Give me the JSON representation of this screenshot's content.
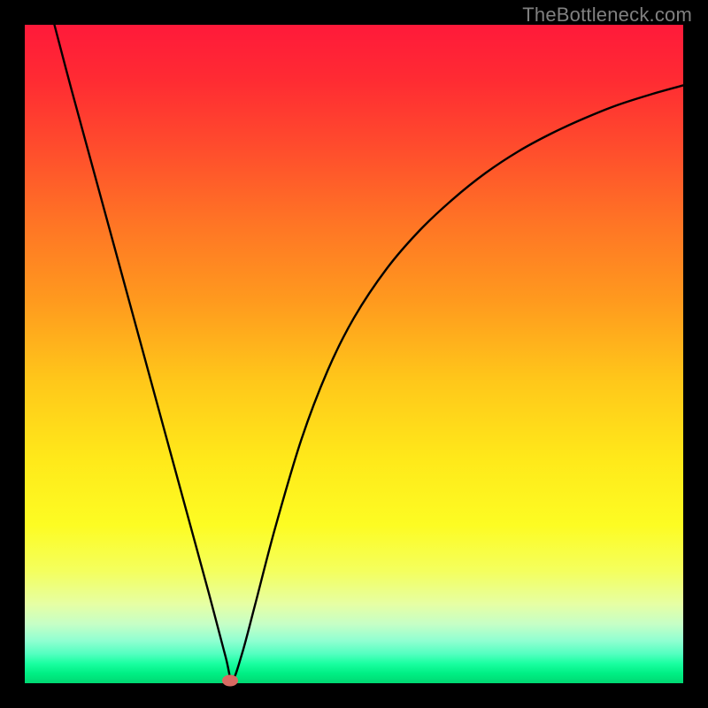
{
  "watermark": "TheBottleneck.com",
  "chart_data": {
    "type": "line",
    "title": "",
    "xlabel": "",
    "ylabel": "",
    "xlim": [
      0,
      1
    ],
    "ylim": [
      0,
      1
    ],
    "series": [
      {
        "name": "bottleneck-curve",
        "x": [
          0.045,
          0.07,
          0.1,
          0.13,
          0.16,
          0.19,
          0.22,
          0.25,
          0.28,
          0.305,
          0.315,
          0.33,
          0.35,
          0.38,
          0.42,
          0.46,
          0.5,
          0.55,
          0.6,
          0.65,
          0.7,
          0.75,
          0.8,
          0.85,
          0.9,
          0.95,
          1.0
        ],
        "y": [
          1.0,
          0.905,
          0.795,
          0.685,
          0.575,
          0.465,
          0.355,
          0.245,
          0.135,
          0.04,
          0.005,
          0.045,
          0.12,
          0.235,
          0.37,
          0.475,
          0.555,
          0.63,
          0.688,
          0.735,
          0.775,
          0.808,
          0.835,
          0.858,
          0.878,
          0.894,
          0.908
        ]
      }
    ],
    "annotations": [
      {
        "name": "minimum-marker",
        "x": 0.312,
        "y": 0.004,
        "color": "#d86a62"
      }
    ],
    "grid": false,
    "legend": false
  },
  "colors": {
    "background": "#000000",
    "curve": "#000000",
    "gradient_top": "#ff1a3a",
    "gradient_bottom": "#00d872",
    "watermark": "#808080",
    "marker": "#d86a62"
  }
}
